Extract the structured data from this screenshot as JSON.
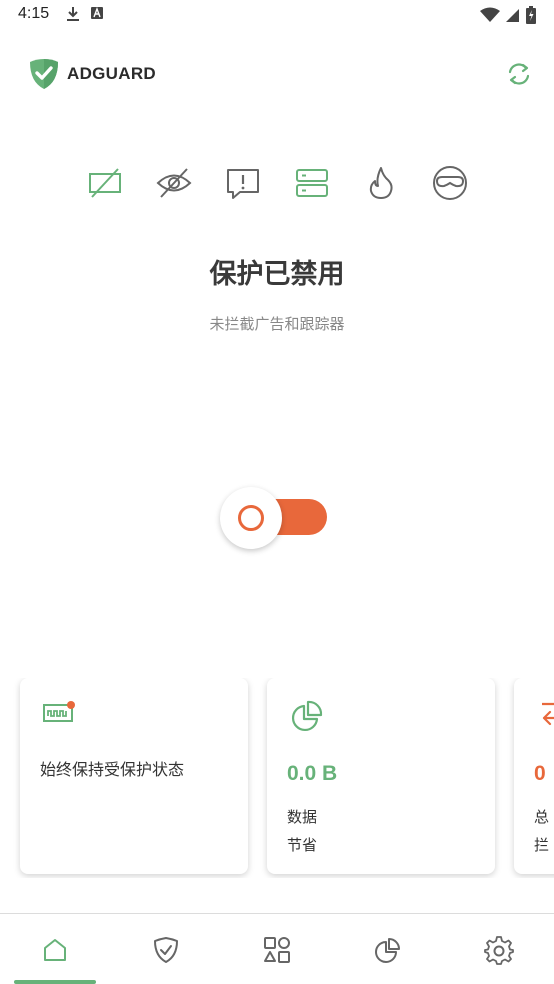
{
  "status_bar": {
    "time": "4:15"
  },
  "header": {
    "logo_text": "ADGUARD"
  },
  "features": [
    {
      "icon": "ad-block-icon",
      "active": true
    },
    {
      "icon": "tracking-protection-icon",
      "active": false
    },
    {
      "icon": "annoyance-icon",
      "active": false
    },
    {
      "icon": "dns-icon",
      "active": true
    },
    {
      "icon": "firewall-icon",
      "active": false
    },
    {
      "icon": "stealth-mode-icon",
      "active": false
    }
  ],
  "status": {
    "title": "保护已禁用",
    "subtitle": "未拦截广告和跟踪器"
  },
  "toggle": {
    "state": "off"
  },
  "cards": {
    "always_on": {
      "text": "始终保持受保护状态"
    },
    "data_saved": {
      "value": "0.0 B",
      "label_line1": "数据",
      "label_line2": "节省"
    },
    "blocked": {
      "value": "0",
      "label_line1": "总",
      "label_line2": "拦"
    }
  },
  "colors": {
    "brand_green": "#67b279",
    "disabled_orange": "#e8683b",
    "icon_gray": "#666666"
  },
  "bottom_nav": [
    {
      "icon": "home-icon",
      "active": true
    },
    {
      "icon": "shield-check-icon",
      "active": false
    },
    {
      "icon": "apps-icon",
      "active": false
    },
    {
      "icon": "statistics-icon",
      "active": false
    },
    {
      "icon": "settings-icon",
      "active": false
    }
  ]
}
